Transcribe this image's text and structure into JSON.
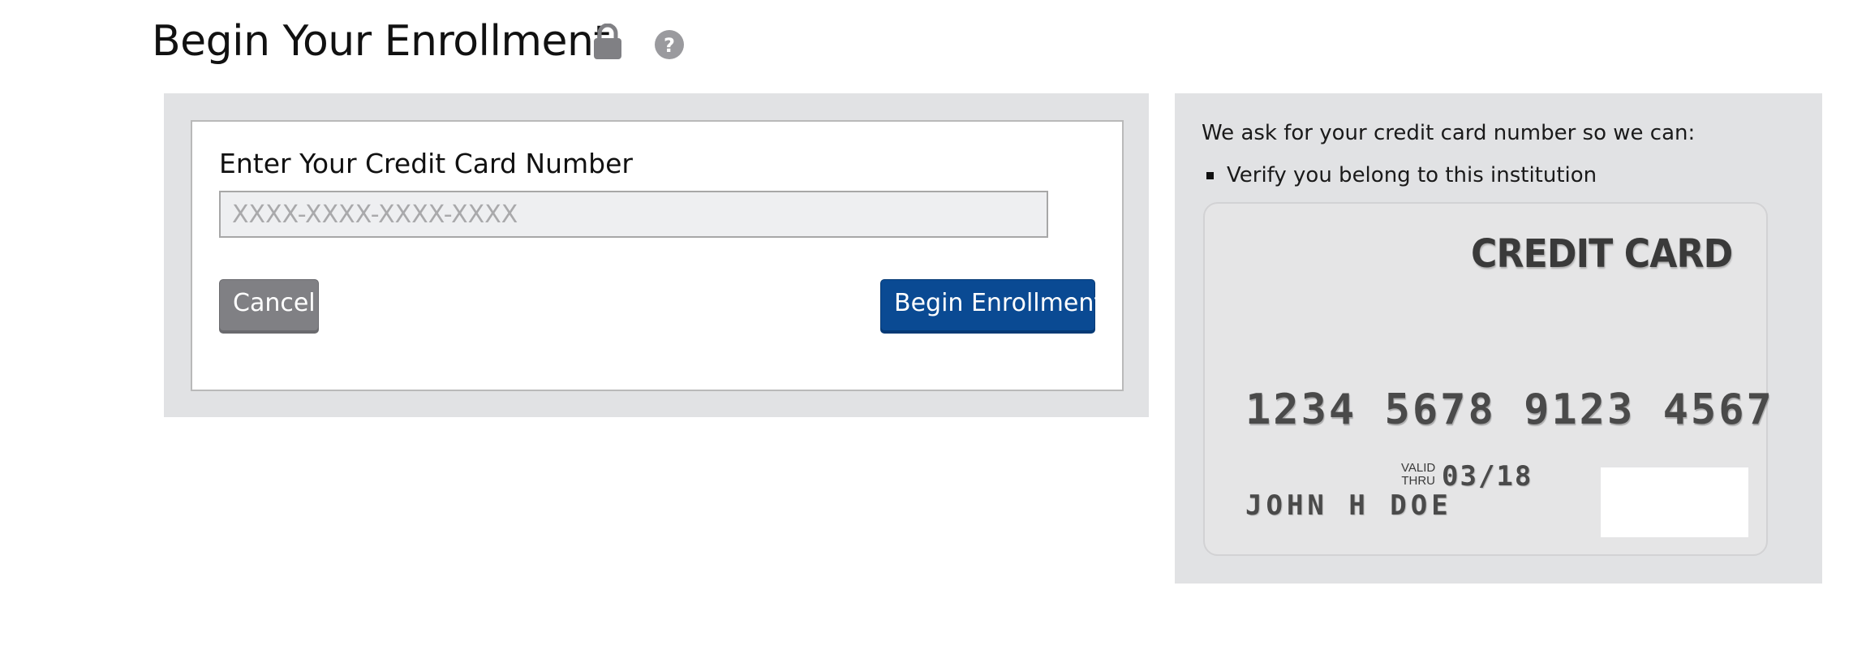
{
  "header": {
    "title": "Begin Your Enrollment",
    "icons": {
      "lock": "lock-icon",
      "help": "help-icon"
    }
  },
  "form": {
    "label": "Enter Your Credit Card Number",
    "input": {
      "value": "",
      "placeholder": "XXXX-XXXX-XXXX-XXXX"
    },
    "cancel_label": "Cancel",
    "submit_label": "Begin Enrollment"
  },
  "info": {
    "intro": "We ask for your credit card number so we can:",
    "items": [
      "Verify you belong to this institution"
    ]
  },
  "card_illustration": {
    "title": "CREDIT CARD",
    "number": "1234 5678 9123 4567",
    "valid_line1": "VALID",
    "valid_line2": "THRU",
    "expiry": "03/18",
    "holder": "JOHN H DOE"
  },
  "colors": {
    "panel_bg": "#e1e2e4",
    "primary_button": "#0a4a93",
    "secondary_button": "#808084",
    "icon_gray": "#808084"
  }
}
